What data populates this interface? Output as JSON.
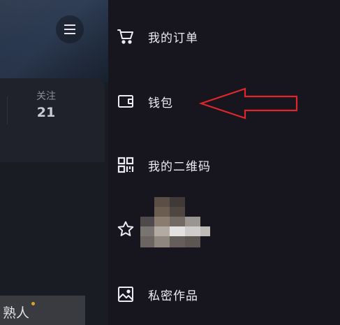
{
  "profile": {
    "stats": [
      {
        "label": "关注",
        "value": "21"
      }
    ],
    "tab": {
      "label": "熟人"
    }
  },
  "drawer": {
    "items": [
      {
        "label": "我的订单",
        "icon": "cart-icon"
      },
      {
        "label": "钱包",
        "icon": "wallet-icon"
      },
      {
        "label": "我的二维码",
        "icon": "qr-code-icon"
      },
      {
        "label": "",
        "icon": "star-icon"
      },
      {
        "label": "私密作品",
        "icon": "private-image-icon"
      }
    ]
  },
  "colors": {
    "drawer_bg": "#17161f",
    "annotation_arrow": "#e0262b",
    "notification_dot": "#d8a52b"
  }
}
